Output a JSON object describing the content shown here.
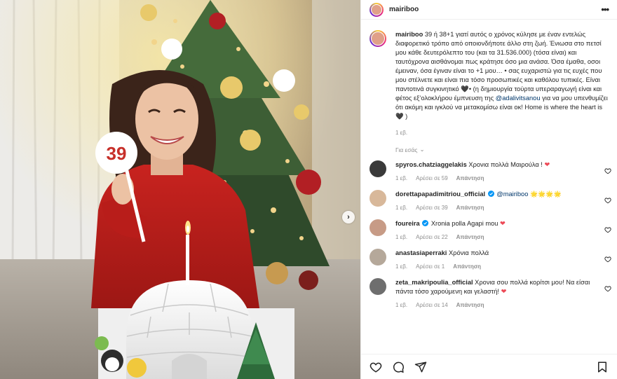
{
  "post": {
    "author": "mairiboo",
    "caption": {
      "username": "mairiboo",
      "text_1": "39 ή 38+1 γιατί αυτός ο χρόνος κύλησε με έναν εντελώς διαφορετικό τρόπο από οποιονδήποτε άλλο στη ζωή. Ένιωσα στο πετσί μου κάθε δευτερόλεπτο του (και τα 31.536.000) (τόσα είναι) και ταυτόχρονα αισθάνομαι πως κράτησε όσο μια ανάσα. Όσα έμαθα, οσοι έμειναν, όσα έγιναν είναι το +1 μου… • σας ευχαριστώ για τις ευχές που μου στέλνετε και είναι πια τόσο προσωπικές και καθόλου τυπικές. Είναι παντοτινά συγκινητικό 🖤• (η δημιουργία τούρτα υπεραραγωγή είναι και φέτος εξ’ολοκλήρου έμπνευση της",
      "mention": "@adalivitsanou",
      "text_2": "για να μου υπενθυμίζει ότι ακόμη και ιγκλού να μετακομίσω είναι οκ! Home is where the heart is 🖤 )",
      "time": "1 εβ."
    },
    "translate_label": "Για εσάς",
    "cake_candle_number": "39"
  },
  "comments": [
    {
      "username": "spyros.chatziaggelakis",
      "text": "Χρονια πολλά Μαιρούλα !",
      "emoji": "❤",
      "time": "1 εβ.",
      "likes": "Αρέσει σε 59",
      "reply": "Απάντηση",
      "avatar_color": "#3a3a3a",
      "verified": false
    },
    {
      "username": "dorettapapadimitriou_official",
      "text": "@mairiboo",
      "emoji": "🌟🌟🌟🌟",
      "time": "1 εβ.",
      "likes": "Αρέσει σε 39",
      "reply": "Απάντηση",
      "avatar_color": "#d8b89a",
      "verified": true
    },
    {
      "username": "foureira",
      "text": "Xronia polla Agapi mou",
      "emoji": "❤",
      "time": "1 εβ.",
      "likes": "Αρέσει σε 22",
      "reply": "Απάντηση",
      "avatar_color": "#c79b86",
      "verified": true
    },
    {
      "username": "anastasiaperraki",
      "text": "Χρόνια πολλά",
      "emoji": "",
      "time": "1 εβ.",
      "likes": "Αρέσει σε 1",
      "reply": "Απάντηση",
      "avatar_color": "#b5a89a",
      "verified": false
    },
    {
      "username": "zeta_makripoulia_official",
      "text": "Χρονια σου πολλά κορίτσι μου! Να είσαι πάντα τόσο χαρούμενη και γελαστή!",
      "emoji": "❤",
      "time": "1 εβ.",
      "likes": "Αρέσει σε 14",
      "reply": "Απάντηση",
      "avatar_color": "#6e6e6e",
      "verified": false
    }
  ],
  "colors": {
    "link": "#00376b",
    "muted": "#8e8e8e",
    "verified": "#0095f6",
    "heart": "#ed4956"
  },
  "icons": {
    "more": "more-options-icon",
    "like": "heart-icon",
    "comment": "comment-icon",
    "share": "share-icon",
    "save": "bookmark-icon",
    "next": "chevron-right-icon"
  }
}
